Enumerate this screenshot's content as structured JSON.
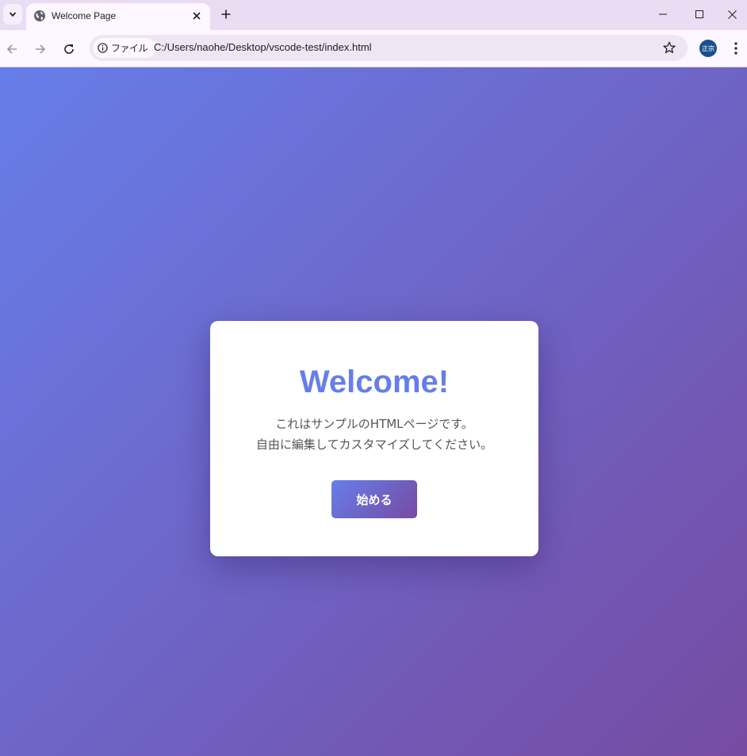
{
  "browser": {
    "tab": {
      "title": "Welcome Page"
    },
    "address_bar": {
      "chip_label": "ファイル",
      "url": "C:/Users/naohe/Desktop/vscode-test/index.html"
    },
    "profile_avatar_label": "正宗"
  },
  "page": {
    "background_gradient": [
      "#667eea",
      "#764ba2"
    ],
    "card": {
      "title": "Welcome!",
      "lines": [
        "これはサンプルのHTMLページです。",
        "自由に編集してカスタマイズしてください。"
      ],
      "button_label": "始める"
    }
  }
}
